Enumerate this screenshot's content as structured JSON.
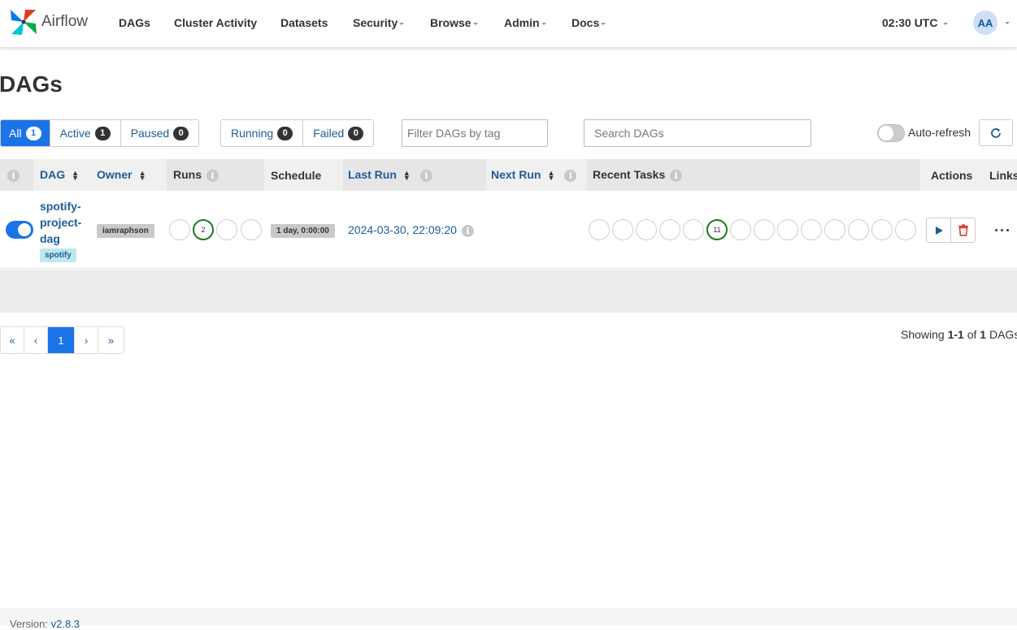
{
  "navbar": {
    "brand": "Airflow",
    "items": [
      {
        "label": "DAGs",
        "dropdown": false
      },
      {
        "label": "Cluster Activity",
        "dropdown": false
      },
      {
        "label": "Datasets",
        "dropdown": false
      },
      {
        "label": "Security",
        "dropdown": true
      },
      {
        "label": "Browse",
        "dropdown": true
      },
      {
        "label": "Admin",
        "dropdown": true
      },
      {
        "label": "Docs",
        "dropdown": true
      }
    ],
    "clock": "02:30 UTC",
    "avatar_initials": "AA"
  },
  "page_title": "DAGs",
  "status_filters": [
    {
      "label": "All",
      "count": "1",
      "active": true
    },
    {
      "label": "Active",
      "count": "1",
      "active": false
    },
    {
      "label": "Paused",
      "count": "0",
      "active": false
    }
  ],
  "run_filters": [
    {
      "label": "Running",
      "count": "0"
    },
    {
      "label": "Failed",
      "count": "0"
    }
  ],
  "tag_filter_placeholder": "Filter DAGs by tag",
  "search_placeholder": "Search DAGs",
  "auto_refresh_label": "Auto-refresh",
  "table": {
    "headers": {
      "dag": "DAG",
      "owner": "Owner",
      "runs": "Runs",
      "schedule": "Schedule",
      "last_run": "Last Run",
      "next_run": "Next Run",
      "recent_tasks": "Recent Tasks",
      "actions": "Actions",
      "links": "Links"
    },
    "rows": [
      {
        "dag_id": "spotify-project-dag",
        "dag_id_lines": [
          "spotify-",
          "project-",
          "dag"
        ],
        "tag": "spotify",
        "owner": "iamraphson",
        "runs": [
          "",
          "2",
          "",
          ""
        ],
        "schedule": "1 day, 0:00:00",
        "last_run": "2024-03-30, 22:09:20",
        "recent_tasks": [
          "",
          "",
          "",
          "",
          "",
          "11",
          "",
          "",
          "",
          "",
          "",
          "",
          "",
          ""
        ],
        "paused": false
      }
    ]
  },
  "pagination": {
    "first": "«",
    "prev": "‹",
    "current": "1",
    "next": "›",
    "last": "»"
  },
  "showing": {
    "prefix": "Showing",
    "range": "1-1",
    "of": "of",
    "total": "1",
    "suffix": "DAGs"
  },
  "footer": {
    "version_label": "Version:",
    "version": "v2.8.3"
  },
  "colors": {
    "primary": "#1b73e8",
    "link": "#1d5c99",
    "success": "#1e7b1e",
    "danger": "#d9342b"
  }
}
